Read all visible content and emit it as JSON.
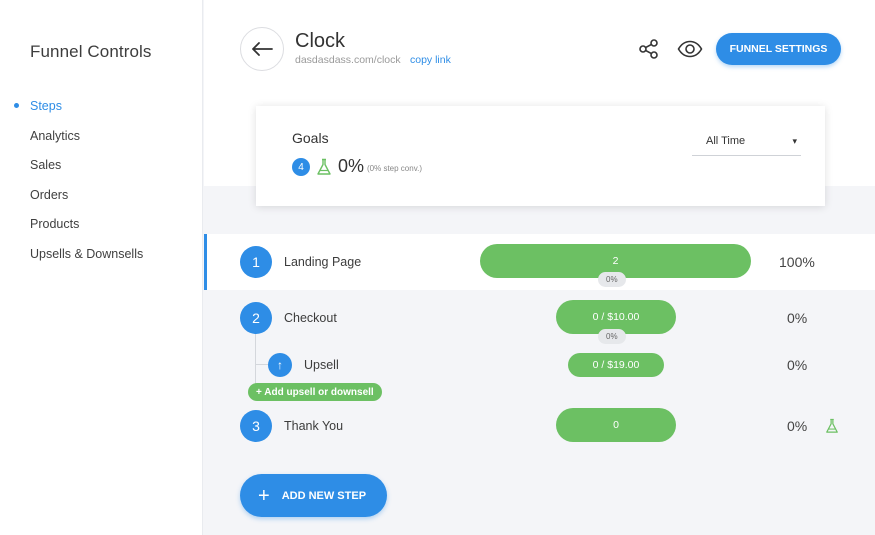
{
  "sidebar": {
    "title": "Funnel Controls",
    "items": [
      {
        "label": "Steps",
        "active": true
      },
      {
        "label": "Analytics"
      },
      {
        "label": "Sales"
      },
      {
        "label": "Orders"
      },
      {
        "label": "Products"
      },
      {
        "label": "Upsells & Downsells"
      }
    ]
  },
  "header": {
    "title": "Clock",
    "url": "dasdasdass.com/clock",
    "copy_link": "copy link",
    "settings_label": "FUNNEL SETTINGS",
    "icons": [
      "back-arrow-icon",
      "share-icon",
      "eye-icon"
    ]
  },
  "goals": {
    "title": "Goals",
    "badge": "4",
    "percent": "0%",
    "conversion": "(0% step conv.)",
    "time_filter": "All Time",
    "time_caret": "▾"
  },
  "steps": [
    {
      "number": "1",
      "label": "Landing Page",
      "bar": "2",
      "pill": "0%",
      "percent": "100%"
    },
    {
      "number": "2",
      "label": "Checkout",
      "bar": "0 / $10.00",
      "pill": "0%",
      "percent": "0%"
    },
    {
      "number": "↑",
      "label": "Upsell",
      "bar": "0 / $19.00",
      "percent": "0%",
      "sub": true
    },
    {
      "number": "3",
      "label": "Thank You",
      "bar": "0",
      "percent": "0%"
    }
  ],
  "add_upsell_label": "+ Add upsell or downsell",
  "add_step": {
    "plus": "+",
    "label": "ADD NEW STEP"
  },
  "colors": {
    "accent": "#2e8de6",
    "success": "#6cc063"
  }
}
